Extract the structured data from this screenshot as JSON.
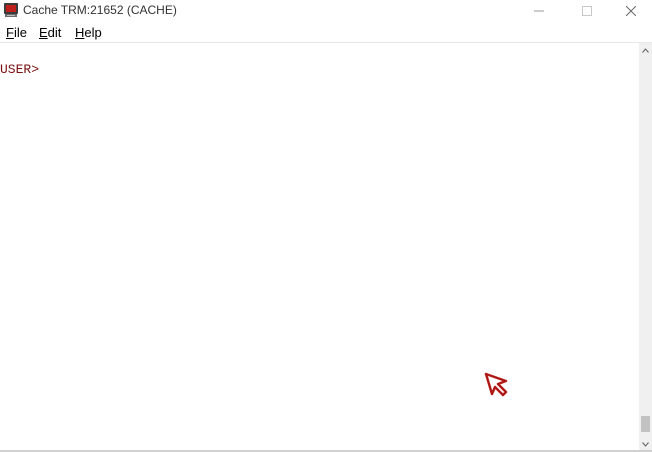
{
  "window": {
    "title": "Cache TRM:21652 (CACHE)"
  },
  "menu": {
    "file_prefix": "",
    "file_mnemonic": "F",
    "file_rest": "ile",
    "edit_mnemonic": "E",
    "edit_rest": "dit",
    "help_mnemonic": "H",
    "help_rest": "elp"
  },
  "terminal": {
    "prompt": "USER>"
  },
  "icons": {
    "app": "terminal-app-icon",
    "minimize": "minimize-icon",
    "maximize": "maximize-icon",
    "close": "close-icon",
    "scroll_up": "chevron-up-icon",
    "scroll_down": "chevron-down-icon",
    "cursor": "mouse-cursor-icon"
  },
  "colors": {
    "prompt_text": "#7a1010",
    "cursor_accent": "#c0201c"
  }
}
